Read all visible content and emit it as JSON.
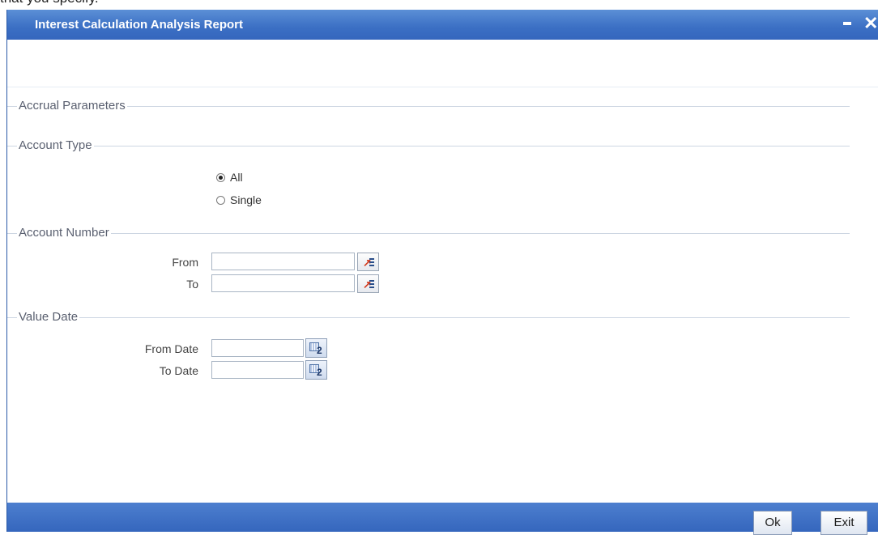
{
  "caption_text": "that you specify.",
  "window": {
    "title": "Interest Calculation Analysis Report"
  },
  "sections": {
    "accrual": "Accrual Parameters",
    "account_type": "Account Type",
    "account_number": "Account Number",
    "value_date": "Value Date"
  },
  "account_type_options": [
    {
      "label": "All",
      "checked": true
    },
    {
      "label": "Single",
      "checked": false
    }
  ],
  "account_number": {
    "from_label": "From",
    "from_value": "",
    "to_label": "To",
    "to_value": ""
  },
  "value_date": {
    "from_label": "From Date",
    "from_value": "",
    "to_label": "To Date",
    "to_value": ""
  },
  "buttons": {
    "ok": "Ok",
    "exit": "Exit"
  },
  "icons": {
    "minimize": "minimize-icon",
    "close": "close-icon",
    "close_glyph": "✕",
    "lov": "list-of-values-icon",
    "calendar": "calendar-icon",
    "calendar_num": "2"
  },
  "colors": {
    "titlebar": "#3b6fc4",
    "footer": "#3566bd"
  }
}
